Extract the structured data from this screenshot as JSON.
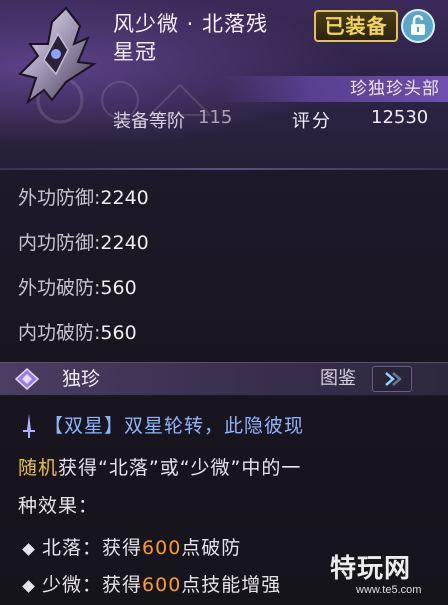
{
  "item": {
    "name_line1": "风少微 · 北落残",
    "name_line2": "星冠",
    "equipped_label": "已装备",
    "rarity_slot": "珍独珍头部",
    "level_label": "装备等阶",
    "level_value": "115",
    "score_label": "评分",
    "score_value": "12530"
  },
  "stats": [
    {
      "label": "外功防御:",
      "value": "2240"
    },
    {
      "label": "内功防御:",
      "value": "2240"
    },
    {
      "label": "外功破防:",
      "value": "560"
    },
    {
      "label": "内功破防:",
      "value": "560"
    }
  ],
  "section": {
    "title": "独珍",
    "codex_label": "图鉴"
  },
  "effect": {
    "bracket_open": "【",
    "name": "双星",
    "bracket_close": "】",
    "desc": "双星轮转，此隐彼现",
    "random_word": "随机",
    "line2_rest": "获得“北落”或“少微”中的一",
    "line3": "种效果：",
    "options": [
      {
        "name": "北落：",
        "pre": "获得",
        "num": "600",
        "post": "点破防"
      },
      {
        "name": "少微：",
        "pre": "获得",
        "num": "600",
        "post": "点技能增强"
      }
    ]
  },
  "watermark": {
    "text_cn": "特玩网",
    "url": "www.te5.com"
  },
  "colors": {
    "equipped_gold": "#e2c452",
    "effect_blue": "#8fb4ff",
    "random_gold": "#e8c14a",
    "number_orange": "#ff9a28"
  }
}
